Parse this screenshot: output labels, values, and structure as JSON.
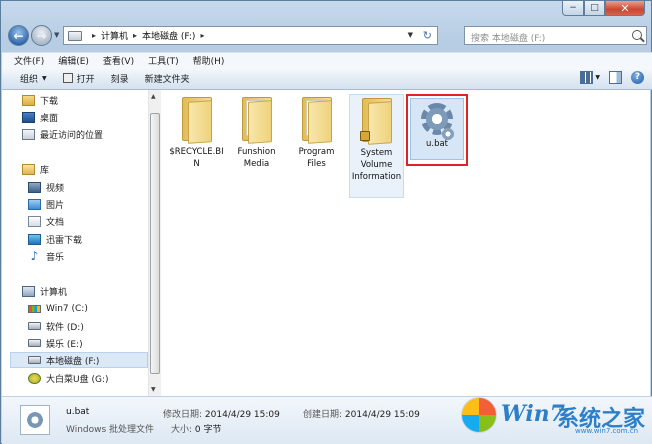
{
  "window": {
    "min_label": "−",
    "max_label": "□",
    "close_label": "✕"
  },
  "address": {
    "crumbs": [
      "计算机",
      "本地磁盘 (F:)"
    ],
    "sep": "▸"
  },
  "search": {
    "placeholder": "搜索 本地磁盘 (F:)"
  },
  "menu": [
    "文件(F)",
    "编辑(E)",
    "查看(V)",
    "工具(T)",
    "帮助(H)"
  ],
  "toolbar": {
    "organize": "组织",
    "open": "打开",
    "print": "刻录",
    "new_folder": "新建文件夹"
  },
  "nav": {
    "favorites": [
      {
        "label": "下载",
        "icon": "download-folder-icon"
      },
      {
        "label": "桌面",
        "icon": "desktop-icon"
      },
      {
        "label": "最近访问的位置",
        "icon": "recent-places-icon"
      }
    ],
    "libraries_label": "库",
    "libraries": [
      {
        "label": "视频",
        "icon": "video-library-icon"
      },
      {
        "label": "图片",
        "icon": "pictures-library-icon"
      },
      {
        "label": "文档",
        "icon": "documents-library-icon"
      },
      {
        "label": "迅雷下载",
        "icon": "xunlei-icon"
      },
      {
        "label": "音乐",
        "icon": "music-library-icon"
      }
    ],
    "computer_label": "计算机",
    "drives": [
      {
        "label": "Win7 (C:)",
        "icon": "windows-drive-icon"
      },
      {
        "label": "软件 (D:)",
        "icon": "drive-icon"
      },
      {
        "label": "娱乐 (E:)",
        "icon": "drive-icon"
      },
      {
        "label": "本地磁盘 (F:)",
        "icon": "drive-icon"
      },
      {
        "label": "大白菜U盘 (G:)",
        "icon": "usb-drive-icon"
      }
    ]
  },
  "files": [
    {
      "name": "$RECYCLE.BIN",
      "type": "folder"
    },
    {
      "name": "Funshion Media",
      "type": "folder"
    },
    {
      "name": "Program Files",
      "type": "folder"
    },
    {
      "name": "System Volume Information",
      "type": "folder-locked"
    },
    {
      "name": "u.bat",
      "type": "batch-file"
    }
  ],
  "details": {
    "name": "u.bat",
    "type": "Windows 批处理文件",
    "modified_label": "修改日期:",
    "modified": "2014/4/29 15:09",
    "created_label": "创建日期:",
    "created": "2014/4/29 15:09",
    "size_label": "大小:",
    "size": "0 字节"
  },
  "watermark": {
    "brand": "Win7",
    "brand2": "系统之家",
    "url": "www.win7.com.cn"
  }
}
